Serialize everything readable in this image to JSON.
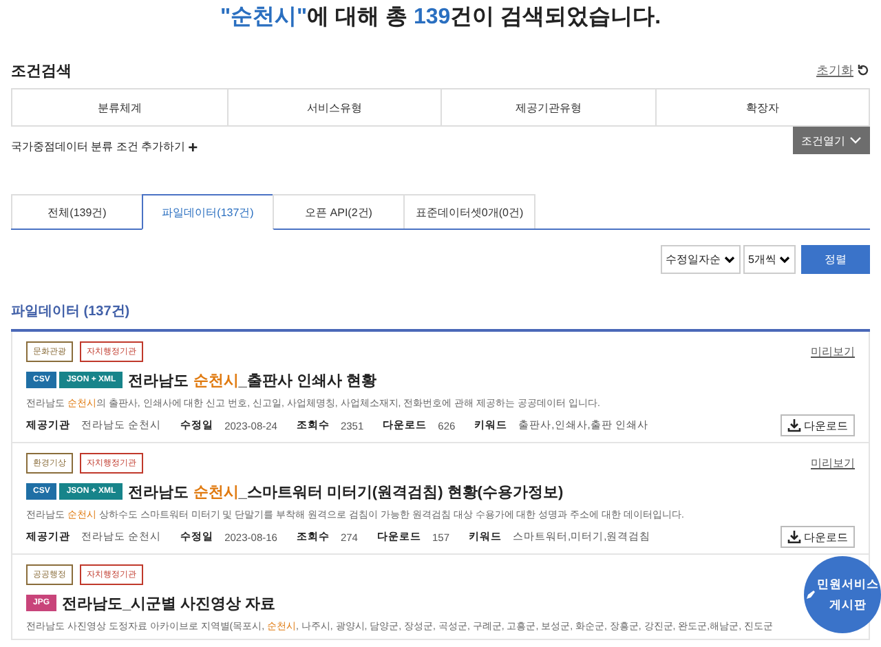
{
  "headline": [
    {
      "text": "\"순천시\"",
      "accent": true
    },
    {
      "text": "에 대해 총 ",
      "accent": false
    },
    {
      "text": "139",
      "accent": true
    },
    {
      "text": "건이 검색되었습니다.",
      "accent": false
    }
  ],
  "filter": {
    "title": "조건검색",
    "reset": "초기화",
    "columns": [
      "분류체계",
      "서비스유형",
      "제공기관유형",
      "확장자"
    ],
    "add_label": "국가중점데이터 분류 조건 추가하기",
    "add_icon": "+",
    "open_button": "조건열기"
  },
  "tabs": [
    {
      "label": "전체(139건)",
      "selected": false
    },
    {
      "label": "파일데이터(137건)",
      "selected": true
    },
    {
      "label": "오픈 API(2건)",
      "selected": false
    },
    {
      "label": "표준데이터셋0개(0건)",
      "selected": false
    }
  ],
  "sort": {
    "order": "수정일자순",
    "per_page": "5개씩",
    "button": "정렬"
  },
  "section_title": "파일데이터 (137건)",
  "results": [
    {
      "tags": [
        {
          "label": "문화관광",
          "color": "#8a6d3b"
        },
        {
          "label": "자치행정기관",
          "color": "#c0392b"
        }
      ],
      "preview": "미리보기",
      "formats": [
        {
          "label": "CSV",
          "color": "#1f6fa5"
        },
        {
          "label": "JSON + XML",
          "color": "#17848a"
        }
      ],
      "title": [
        {
          "text": "전라남도 ",
          "highlight": false
        },
        {
          "text": "순천시",
          "highlight": true
        },
        {
          "text": "_출판사 인쇄사 현황",
          "highlight": false
        }
      ],
      "description": [
        {
          "text": "전라남도 ",
          "highlight": false
        },
        {
          "text": "순천시",
          "highlight": true
        },
        {
          "text": "의 출판사, 인쇄사에 대한 신고 번호, 신고일, 사업체명칭, 사업체소재지, 전화번호에 관해 제공하는 공공데이터 입니다.",
          "highlight": false
        }
      ],
      "meta": [
        {
          "label": "제공기관",
          "value": "전라남도 순천시"
        },
        {
          "label": "수정일",
          "value": "2023-08-24"
        },
        {
          "label": "조회수",
          "value": "2351"
        },
        {
          "label": "다운로드",
          "value": "626"
        },
        {
          "label": "키워드",
          "value": "출판사,인쇄사,출판 인쇄사"
        }
      ],
      "download": "다운로드"
    },
    {
      "tags": [
        {
          "label": "환경기상",
          "color": "#8a6d3b"
        },
        {
          "label": "자치행정기관",
          "color": "#c0392b"
        }
      ],
      "preview": "미리보기",
      "formats": [
        {
          "label": "CSV",
          "color": "#1f6fa5"
        },
        {
          "label": "JSON + XML",
          "color": "#17848a"
        }
      ],
      "title": [
        {
          "text": "전라남도 ",
          "highlight": false
        },
        {
          "text": "순천시",
          "highlight": true
        },
        {
          "text": "_스마트워터 미터기(원격검침) 현황(수용가정보)",
          "highlight": false
        }
      ],
      "description": [
        {
          "text": "전라남도 ",
          "highlight": false
        },
        {
          "text": "순천시",
          "highlight": true
        },
        {
          "text": " 상하수도 스마트워터 미터기 및 단말기를 부착해 원격으로 검침이 가능한 원격검침 대상 수용가에 대한 성명과 주소에 대한 데이터입니다.",
          "highlight": false
        }
      ],
      "meta": [
        {
          "label": "제공기관",
          "value": "전라남도 순천시"
        },
        {
          "label": "수정일",
          "value": "2023-08-16"
        },
        {
          "label": "조회수",
          "value": "274"
        },
        {
          "label": "다운로드",
          "value": "157"
        },
        {
          "label": "키워드",
          "value": "스마트워터,미터기,원격검침"
        }
      ],
      "download": "다운로드"
    },
    {
      "tags": [
        {
          "label": "공공행정",
          "color": "#8a6d3b"
        },
        {
          "label": "자치행정기관",
          "color": "#c0392b"
        }
      ],
      "formats": [
        {
          "label": "JPG",
          "color": "#c8447a"
        }
      ],
      "title": [
        {
          "text": "전라남도_시군별 사진영상 자료",
          "highlight": false
        }
      ],
      "description": [
        {
          "text": "전라남도 사진영상 도정자료 아카이브로 지역별(목포시, ",
          "highlight": false
        },
        {
          "text": "순천시",
          "highlight": true
        },
        {
          "text": ", 나주시, 광양시, 담양군, 장성군, 곡성군, 구례군, 고흥군, 보성군, 화순군, 장흥군, 강진군, 완도군,해남군, 진도군",
          "highlight": false
        }
      ]
    }
  ],
  "floating_button": "민원서비스 게시판"
}
